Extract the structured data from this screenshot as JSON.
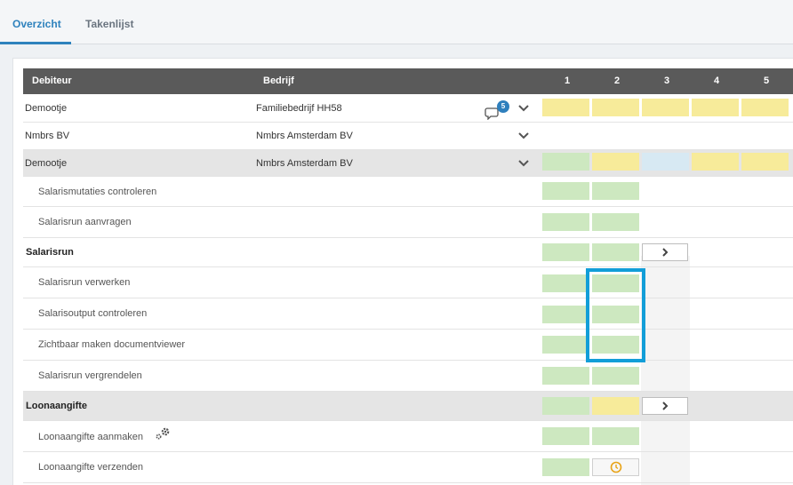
{
  "tabs": [
    {
      "label": "Overzicht",
      "active": true
    },
    {
      "label": "Takenlijst",
      "active": false
    }
  ],
  "table": {
    "headers": {
      "debiteur": "Debiteur",
      "bedrijf": "Bedrijf",
      "periods": [
        "1",
        "2",
        "3",
        "4",
        "5"
      ]
    },
    "rows": [
      {
        "debiteur": "Demootje",
        "bedrijf": "Familiebedrijf HH58",
        "comment_count": "5",
        "cells": [
          "yellow",
          "yellow",
          "yellow",
          "yellow",
          "yellow"
        ]
      },
      {
        "debiteur": "Nmbrs BV",
        "bedrijf": "Nmbrs Amsterdam BV",
        "cells": []
      },
      {
        "debiteur": "Demootje",
        "bedrijf": "Nmbrs Amsterdam BV",
        "selected": true,
        "cells": [
          "green",
          "yellow",
          "blue",
          "yellow",
          "yellow"
        ]
      }
    ],
    "tasks": [
      {
        "label": "Salarismutaties controleren",
        "type": "sub",
        "cells": [
          "green",
          "green",
          "white"
        ]
      },
      {
        "label": "Salarisrun aanvragen",
        "type": "sub",
        "cells": [
          "green",
          "green",
          "white"
        ]
      },
      {
        "label": "Salarisrun",
        "type": "group",
        "cells": [
          "green",
          "green",
          "arrow"
        ]
      },
      {
        "label": "Salarisrun verwerken",
        "type": "sub",
        "cells": [
          "green",
          "green"
        ]
      },
      {
        "label": "Salarisoutput controleren",
        "type": "sub",
        "cells": [
          "green",
          "green"
        ]
      },
      {
        "label": "Zichtbaar maken documentviewer",
        "type": "sub",
        "cells": [
          "green",
          "green"
        ]
      },
      {
        "label": "Salarisrun vergrendelen",
        "type": "sub",
        "cells": [
          "green",
          "green"
        ]
      },
      {
        "label": "Loonaangifte",
        "type": "group",
        "cells": [
          "green",
          "yellow",
          "arrow"
        ]
      },
      {
        "label": "Loonaangifte aanmaken",
        "type": "sub",
        "has_gear": true,
        "cells": [
          "green",
          "green"
        ]
      },
      {
        "label": "Loonaangifte verzenden",
        "type": "sub",
        "cells": [
          "green",
          "clock"
        ]
      }
    ]
  },
  "colors": {
    "green": "#cde8c0",
    "yellow": "#f7eb9a",
    "blue": "#d7e9f3",
    "accent": "#2e82bd",
    "highlight": "#129ed8"
  }
}
